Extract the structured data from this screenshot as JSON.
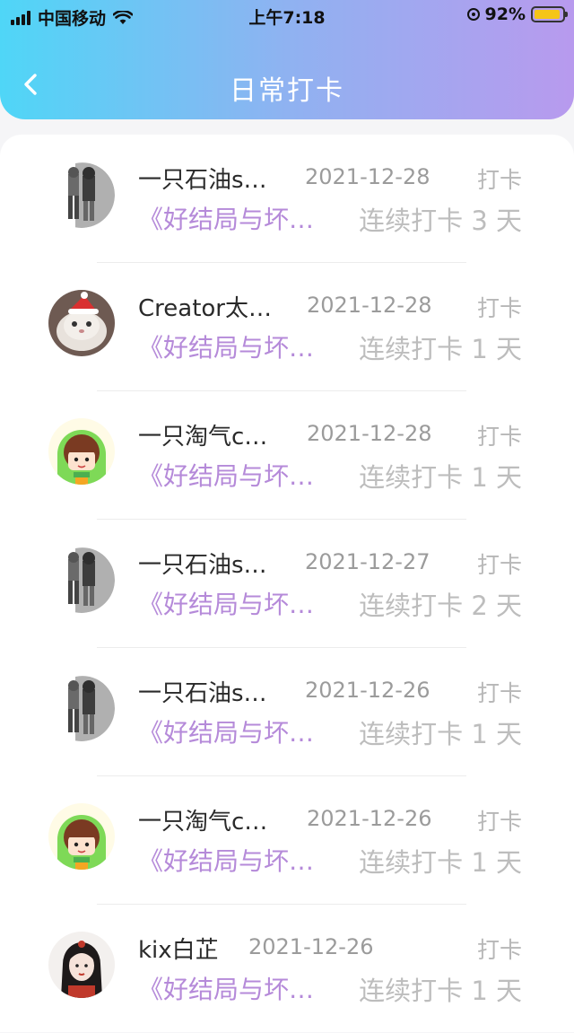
{
  "status_bar": {
    "carrier": "中国移动",
    "time": "上午7:18",
    "battery": "92%",
    "battery_level": 0.92
  },
  "nav": {
    "title": "日常打卡",
    "back_icon": "chevron-left-icon"
  },
  "colors": {
    "header_gradient_start": "#4fd6f7",
    "header_gradient_end": "#b89aee",
    "book_text": "#b58ad9"
  },
  "records": [
    {
      "name": "一只石油s…",
      "date": "2021-12-28",
      "action": "打卡",
      "book": "《好结局与坏…",
      "streak": "连续打卡 3 天",
      "avatar": "grey-figures"
    },
    {
      "name": "Creator太…",
      "date": "2021-12-28",
      "action": "打卡",
      "book": "《好结局与坏…",
      "streak": "连续打卡 1 天",
      "avatar": "cat-santa-hat"
    },
    {
      "name": "一只淘气c…",
      "date": "2021-12-28",
      "action": "打卡",
      "book": "《好结局与坏…",
      "streak": "连续打卡 1 天",
      "avatar": "green-hood-girl"
    },
    {
      "name": "一只石油s…",
      "date": "2021-12-27",
      "action": "打卡",
      "book": "《好结局与坏…",
      "streak": "连续打卡 2 天",
      "avatar": "grey-figures"
    },
    {
      "name": "一只石油s…",
      "date": "2021-12-26",
      "action": "打卡",
      "book": "《好结局与坏…",
      "streak": "连续打卡 1 天",
      "avatar": "grey-figures"
    },
    {
      "name": "一只淘气c…",
      "date": "2021-12-26",
      "action": "打卡",
      "book": "《好结局与坏…",
      "streak": "连续打卡 1 天",
      "avatar": "green-hood-girl"
    },
    {
      "name": "kix白芷",
      "date": "2021-12-26",
      "action": "打卡",
      "book": "《好结局与坏…",
      "streak": "连续打卡 1 天",
      "avatar": "girl-portrait"
    }
  ]
}
